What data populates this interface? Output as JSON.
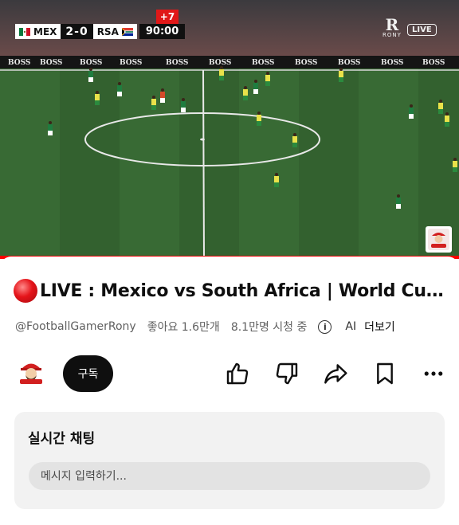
{
  "player": {
    "scoreboard": {
      "home_team": "MEX",
      "away_team": "RSA",
      "score": "2-0",
      "clock": "90:00",
      "added_time": "+7"
    },
    "brand_name": "RONY",
    "brand_letter": "R",
    "live_badge": "LIVE",
    "sponsor_board": "BOSS",
    "progress_fraction": 1.0,
    "colors": {
      "pitch": "#2f5a2c",
      "progress": "#ff0000",
      "added_time_bg": "#e01818"
    }
  },
  "video": {
    "title": "LIVE : Mexico vs South Africa | World Cu…",
    "channel_handle": "@FootballGamerRony",
    "likes": "좋아요 1.6만개",
    "viewers": "8.1만명 시청 중",
    "ai_label": "AI",
    "more_label": "더보기"
  },
  "actions": {
    "subscribe_label": "구독",
    "icons": [
      "thumbs-up-icon",
      "thumbs-down-icon",
      "share-icon",
      "save-icon",
      "more-icon"
    ]
  },
  "chat": {
    "title": "실시간 채팅",
    "input_placeholder": "메시지 입력하기..."
  }
}
